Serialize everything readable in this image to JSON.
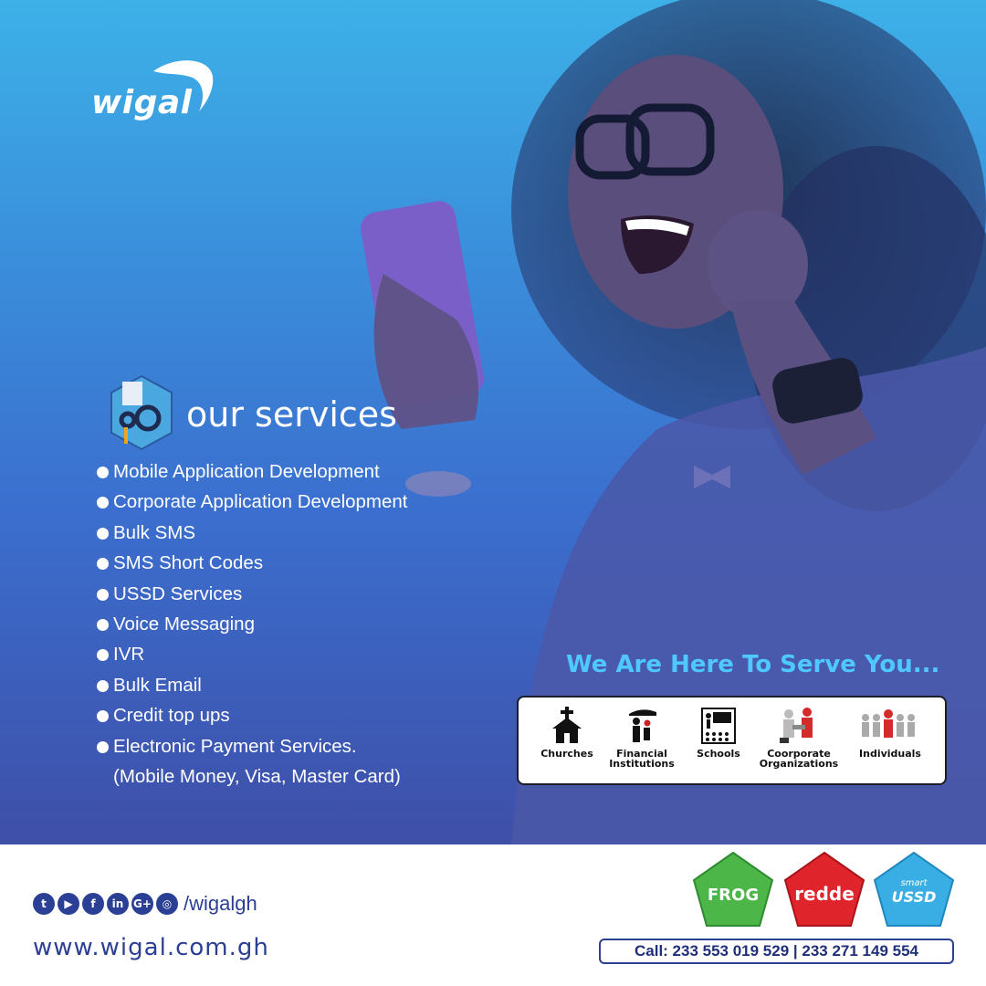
{
  "brand": {
    "logo_text": "wigal"
  },
  "services": {
    "title": "our services",
    "items": [
      "Mobile Application Development",
      "Corporate Application Development",
      "Bulk SMS",
      "SMS Short Codes",
      "USSD Services",
      "Voice Messaging",
      "IVR",
      "Bulk Email",
      "Credit top ups",
      "Electronic Payment Services."
    ],
    "sub_note": "(Mobile Money, Visa, Master Card)"
  },
  "serve": {
    "title": "We Are Here To Serve You...",
    "segments": [
      {
        "line1": "Churches",
        "line2": "",
        "icon": "church-icon"
      },
      {
        "line1": "Financial",
        "line2": "Institutions",
        "icon": "family-umbrella-icon"
      },
      {
        "line1": "Schools",
        "line2": "",
        "icon": "classroom-icon"
      },
      {
        "line1": "Coorporate",
        "line2": "Organizations",
        "icon": "handshake-icon"
      },
      {
        "line1": "Individuals",
        "line2": "",
        "icon": "people-group-icon"
      }
    ]
  },
  "footer": {
    "social_handle": "/wigalgh",
    "social_icons": [
      "twitter-icon",
      "youtube-icon",
      "facebook-icon",
      "linkedin-icon",
      "google-plus-icon",
      "instagram-icon"
    ],
    "website": "www.wigal.com.gh",
    "call": "Call: 233 553 019 529 | 233 271 149 554",
    "badges": [
      {
        "label": "FROG",
        "color": "#4cb648"
      },
      {
        "label": "redde",
        "color": "#e0242b"
      },
      {
        "label": "smart USSD",
        "top": "smart",
        "bottom": "USSD",
        "color": "#39aee4"
      }
    ]
  },
  "colors": {
    "accent": "#4fc8ff",
    "brand_blue": "#2b3f94"
  }
}
